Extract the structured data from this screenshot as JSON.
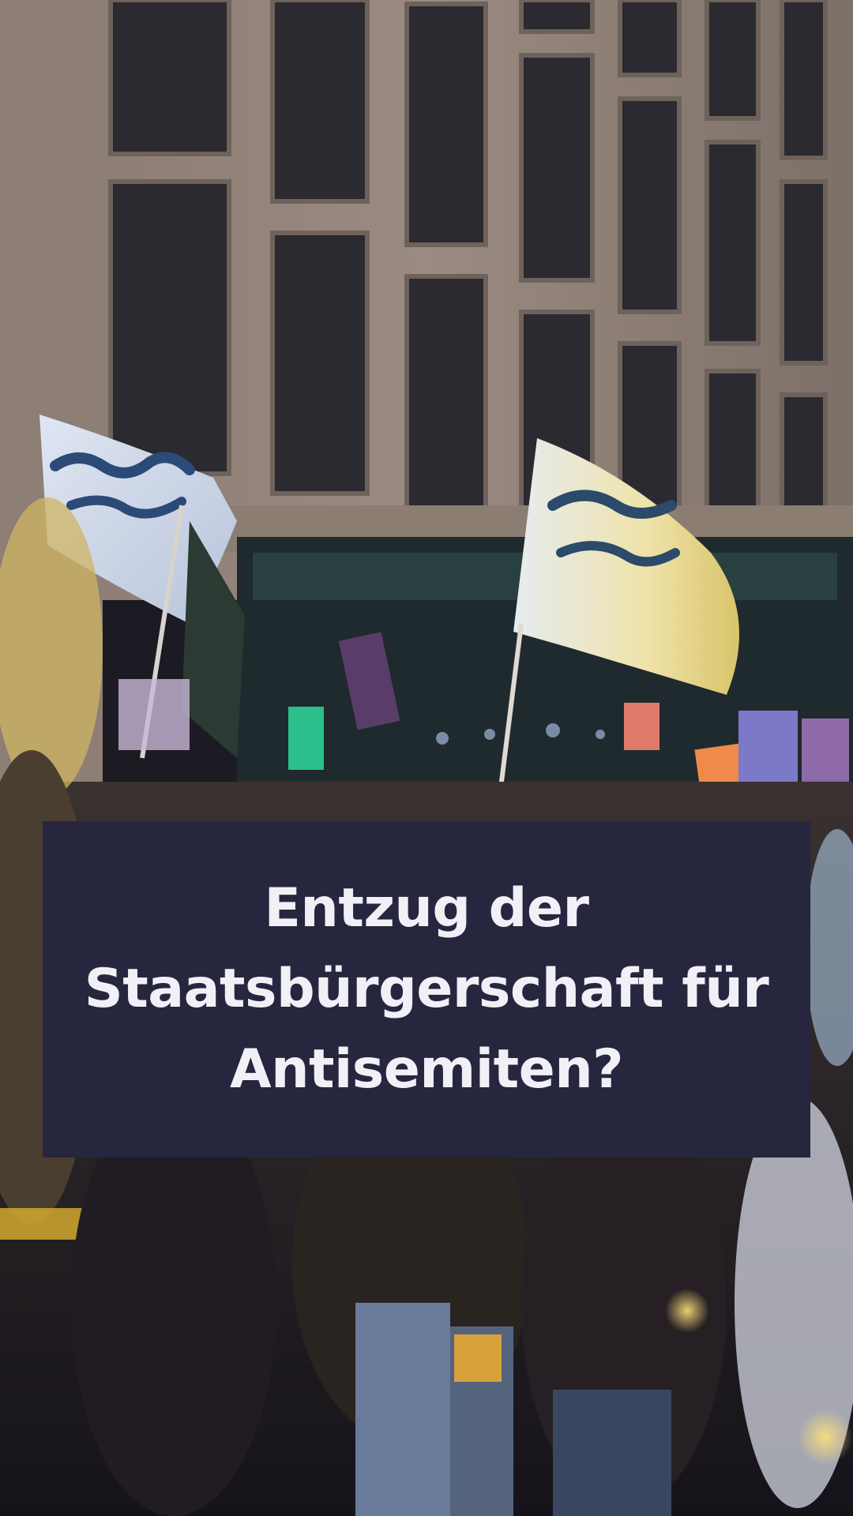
{
  "caption": {
    "line1": "Entzug der",
    "line2": "Staatsbürgerschaft für",
    "line3": "Antisemiten?"
  },
  "colors": {
    "caption_background": "#27263f",
    "caption_text": "#f1f0f6"
  }
}
